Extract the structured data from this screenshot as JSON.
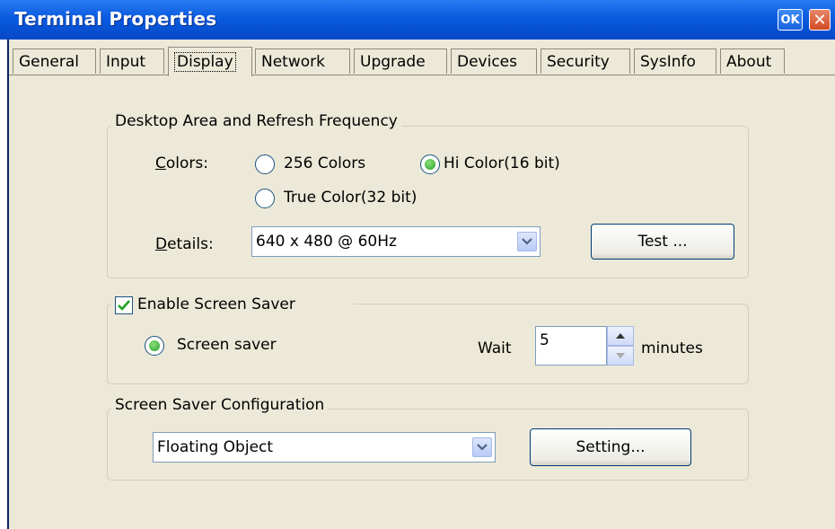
{
  "window": {
    "title": "Terminal Properties",
    "ok_label": "OK",
    "close_glyph": "✕"
  },
  "tabs": [
    "General",
    "Input",
    "Display",
    "Network",
    "Upgrade",
    "Devices",
    "Security",
    "SysInfo",
    "About"
  ],
  "active_tab": "Display",
  "desktop_area": {
    "title": "Desktop Area and Refresh Frequency",
    "colors_label": "Colors:",
    "radio_256": "256 Colors",
    "radio_16bit": "Hi Color(16 bit)",
    "radio_32bit": "True Color(32 bit)",
    "selected_color": "Hi Color(16 bit)",
    "details_label": "Details:",
    "details_value": "640 x 480 @ 60Hz",
    "test_button": "Test ..."
  },
  "screen_saver": {
    "enable_label": "Enable Screen Saver",
    "enabled": true,
    "radio_label": "Screen saver",
    "wait_label": "Wait",
    "wait_value": "5",
    "minutes_label": "minutes"
  },
  "screen_saver_config": {
    "title": "Screen Saver Configuration",
    "selected": "Floating Object",
    "setting_button": "Setting..."
  }
}
